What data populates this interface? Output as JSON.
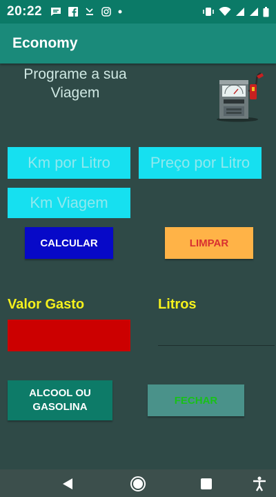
{
  "status_bar": {
    "time": "20:22",
    "left_icons": [
      "message-icon",
      "facebook-icon",
      "missed-call-icon",
      "instagram-icon",
      "dot-icon"
    ],
    "right_icons": [
      "vibrate-icon",
      "wifi-icon",
      "signal-icon",
      "signal-icon",
      "battery-icon"
    ]
  },
  "app_bar": {
    "title": "Economy"
  },
  "header": {
    "text": "Programe a sua Viagem"
  },
  "inputs": {
    "km_por_litro": {
      "placeholder": "Km por Litro",
      "value": ""
    },
    "preco_por_litro": {
      "placeholder": "Preço por Litro",
      "value": ""
    },
    "km_viagem": {
      "placeholder": "Km Viagem",
      "value": ""
    }
  },
  "buttons": {
    "calcular": "CALCULAR",
    "limpar": "LIMPAR",
    "alcool_gasolina": "ALCOOL OU GASOLINA",
    "fechar": "FECHAR"
  },
  "results": {
    "valor_gasto_label": "Valor Gasto",
    "litros_label": "Litros"
  },
  "colors": {
    "background": "#2f4a47",
    "app_bar": "#1a8a7a",
    "input": "#16e0f0",
    "calcular": "#0709c8",
    "limpar": "#ffb347",
    "valor_box": "#cc0000",
    "label_yellow": "#f5f11c"
  },
  "nav_bar": {
    "icons": [
      "back-icon",
      "home-icon",
      "recents-icon",
      "accessibility-icon"
    ]
  }
}
